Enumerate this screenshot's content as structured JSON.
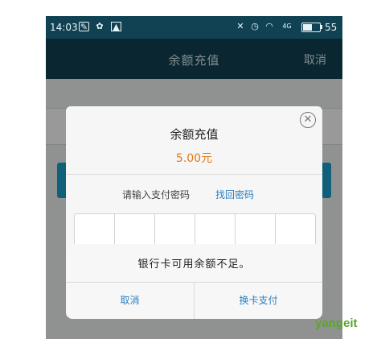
{
  "status_bar": {
    "time": "14:03",
    "network": "4G",
    "battery_level": "55",
    "battery_fraction": 0.55,
    "left_icons": [
      "notification-icon",
      "paw-icon",
      "image-icon"
    ],
    "right_icons": [
      "mute-icon",
      "alarm-icon",
      "wifi-icon",
      "signal-icon",
      "battery-icon"
    ]
  },
  "header": {
    "title": "余额充值",
    "cancel_label": "取消"
  },
  "payment_dialog": {
    "title": "余额充值",
    "amount": "5.00元",
    "prompt": "请输入支付密码",
    "forgot_password": "找回密码",
    "close_icon": "close-circle-icon",
    "password_digits": 6
  },
  "alert": {
    "message": "银行卡可用余额不足。",
    "cancel_label": "取消",
    "change_card_label": "换卡支付"
  },
  "watermark": "yangeit",
  "colors": {
    "header_bg": "#114253",
    "accent_blue": "#2a7fc0",
    "amount_orange": "#e07a19",
    "brand_green": "#5aa52b"
  }
}
